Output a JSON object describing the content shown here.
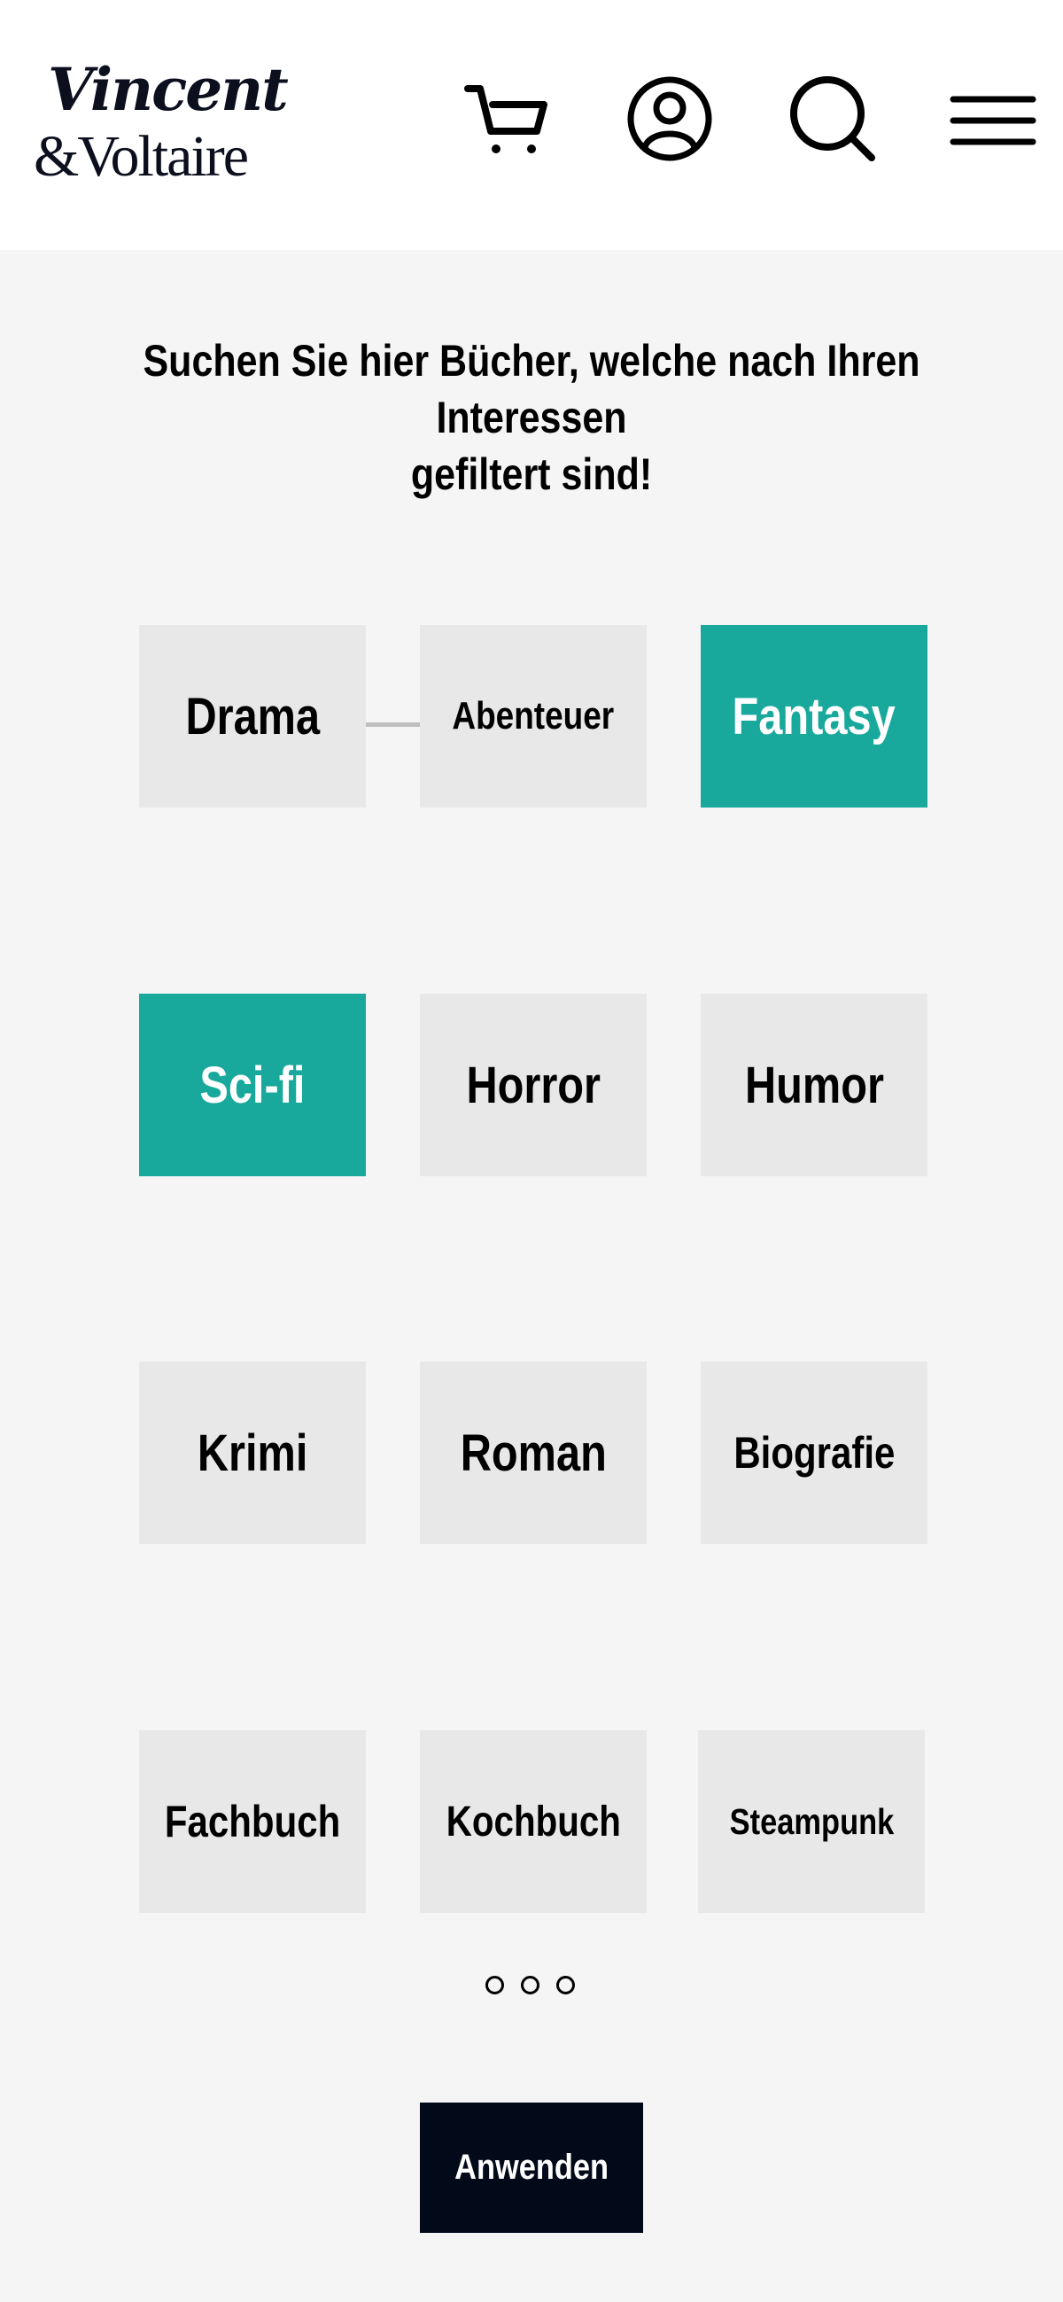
{
  "header": {
    "logo_line1": "Vincent",
    "logo_line2": "&Voltaire",
    "icons": [
      "cart-icon",
      "user-icon",
      "search-icon",
      "menu-icon"
    ]
  },
  "headline": {
    "line1": "Suchen Sie hier Bücher, welche nach Ihren  Interessen",
    "line2": "gefiltert sind!"
  },
  "genres": [
    {
      "label": "Drama",
      "selected": false
    },
    {
      "label": "Abenteuer",
      "selected": false
    },
    {
      "label": "Fantasy",
      "selected": true
    },
    {
      "label": "Sci-fi",
      "selected": true
    },
    {
      "label": "Horror",
      "selected": false
    },
    {
      "label": "Humor",
      "selected": false
    },
    {
      "label": "Krimi",
      "selected": false
    },
    {
      "label": "Roman",
      "selected": false
    },
    {
      "label": "Biografie",
      "selected": false
    },
    {
      "label": "Fachbuch",
      "selected": false
    },
    {
      "label": "Kochbuch",
      "selected": false
    },
    {
      "label": "Steampunk",
      "selected": false
    }
  ],
  "pagination": {
    "pages": 3
  },
  "apply_button": {
    "label": "Anwenden"
  },
  "colors": {
    "selected": "#18a89c",
    "tile": "#e8e8e8",
    "button": "#020a1a",
    "background": "#f5f5f5"
  }
}
